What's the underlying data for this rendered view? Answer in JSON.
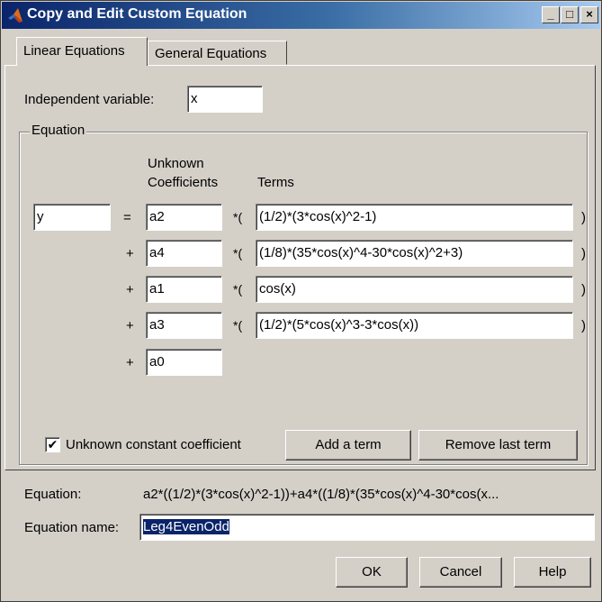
{
  "window": {
    "title": "Copy and Edit Custom Equation",
    "minimize_glyph": "_",
    "maximize_glyph": "□",
    "close_glyph": "×"
  },
  "tabs": [
    {
      "label": "Linear Equations",
      "selected": true
    },
    {
      "label": "General Equations",
      "selected": false
    }
  ],
  "independent_variable": {
    "label": "Independent variable:",
    "value": "x"
  },
  "equation_group": {
    "label": "Equation",
    "unknown_coefficients_header_1": "Unknown",
    "unknown_coefficients_header_2": "Coefficients",
    "terms_header": "Terms",
    "dependent_variable": "y",
    "rows": [
      {
        "operator": "=",
        "coefficient": "a2",
        "times": "*(",
        "term": "(1/2)*(3*cos(x)^2-1)",
        "close": ")"
      },
      {
        "operator": "+",
        "coefficient": "a4",
        "times": "*(",
        "term": "(1/8)*(35*cos(x)^4-30*cos(x)^2+3)",
        "close": ")"
      },
      {
        "operator": "+",
        "coefficient": "a1",
        "times": "*(",
        "term": "cos(x)",
        "close": ")"
      },
      {
        "operator": "+",
        "coefficient": "a3",
        "times": "*(",
        "term": "(1/2)*(5*cos(x)^3-3*cos(x))",
        "close": ")"
      }
    ],
    "constant": {
      "operator": "+",
      "coefficient": "a0"
    },
    "constant_checkbox": {
      "label": "Unknown constant coefficient",
      "checked": true,
      "glyph": "✔"
    },
    "add_term_label": "Add a term",
    "remove_term_label": "Remove last term"
  },
  "equation_display": {
    "label": "Equation:",
    "value": "a2*((1/2)*(3*cos(x)^2-1))+a4*((1/8)*(35*cos(x)^4-30*cos(x..."
  },
  "equation_name": {
    "label": "Equation name:",
    "value": "Leg4EvenOdd"
  },
  "buttons": {
    "ok": "OK",
    "cancel": "Cancel",
    "help": "Help"
  },
  "colors": {
    "title_start": "#0a246a",
    "title_end": "#a6caf0",
    "face": "#d4d0c8",
    "selection": "#0a246a"
  }
}
